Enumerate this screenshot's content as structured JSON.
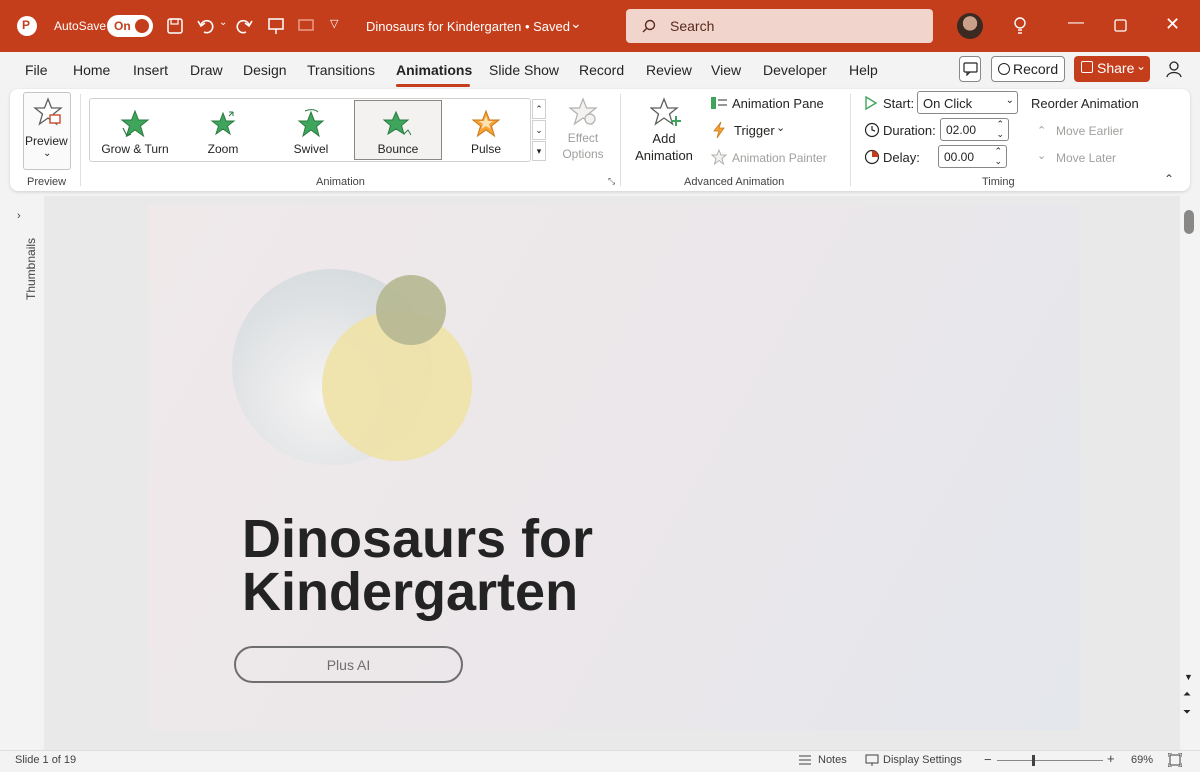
{
  "titlebar": {
    "autosave_label": "AutoSave",
    "autosave_state": "On",
    "doc_title": "Dinosaurs for Kindergarten • Saved",
    "search_placeholder": "Search"
  },
  "menu": {
    "tabs": [
      "File",
      "Home",
      "Insert",
      "Draw",
      "Design",
      "Transitions",
      "Animations",
      "Slide Show",
      "Record",
      "Review",
      "View",
      "Developer",
      "Help"
    ],
    "active_tab": "Animations",
    "record_label": "Record",
    "share_label": "Share"
  },
  "ribbon": {
    "preview_label": "Preview",
    "preview_group": "Preview",
    "animations": [
      "Grow & Turn",
      "Zoom",
      "Swivel",
      "Bounce",
      "Pulse"
    ],
    "selected_animation": "Bounce",
    "effect_options": "Effect Options",
    "animation_group": "Animation",
    "add_animation": "Add Animation",
    "animation_pane": "Animation Pane",
    "trigger": "Trigger",
    "animation_painter": "Animation Painter",
    "advanced_group": "Advanced Animation",
    "start_label": "Start:",
    "start_value": "On Click",
    "duration_label": "Duration:",
    "duration_value": "02.00",
    "delay_label": "Delay:",
    "delay_value": "00.00",
    "timing_group": "Timing",
    "reorder_label": "Reorder Animation",
    "move_earlier": "Move Earlier",
    "move_later": "Move Later"
  },
  "sidebar": {
    "thumbnails_label": "Thumbnails"
  },
  "slide": {
    "title_line1": "Dinosaurs for",
    "title_line2": "Kindergarten",
    "button_label": "Plus AI"
  },
  "status": {
    "slide_count": "Slide 1 of 19",
    "notes": "Notes",
    "display_settings": "Display Settings",
    "zoom": "69%"
  },
  "colors": {
    "accent": "#c43e1c",
    "star_green": "#3fa55c",
    "star_orange": "#f7a234"
  }
}
